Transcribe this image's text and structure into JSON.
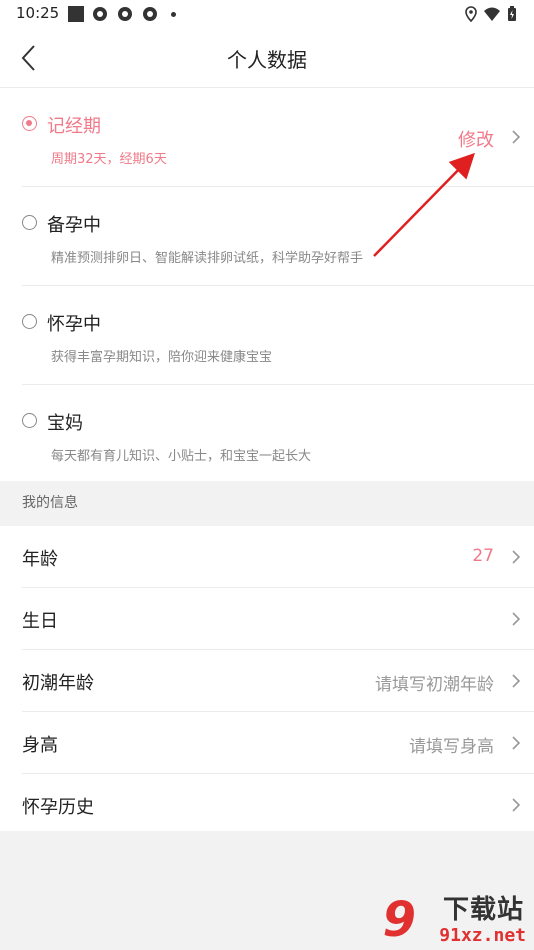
{
  "status_bar": {
    "time": "10:25"
  },
  "header": {
    "title": "个人数据"
  },
  "modes": [
    {
      "name": "记经期",
      "desc": "周期32天，经期6天",
      "selected": true,
      "edit_label": "修改"
    },
    {
      "name": "备孕中",
      "desc": "精准预测排卵日、智能解读排卵试纸，科学助孕好帮手",
      "selected": false
    },
    {
      "name": "怀孕中",
      "desc": "获得丰富孕期知识，陪你迎来健康宝宝",
      "selected": false
    },
    {
      "name": "宝妈",
      "desc": "每天都有育儿知识、小贴士，和宝宝一起长大",
      "selected": false
    }
  ],
  "info_section": {
    "title": "我的信息",
    "rows": [
      {
        "label": "年龄",
        "value": "27"
      },
      {
        "label": "生日",
        "value": ""
      },
      {
        "label": "初潮年龄",
        "value": "请填写初潮年龄"
      },
      {
        "label": "身高",
        "value": "请填写身高"
      },
      {
        "label": "怀孕历史",
        "value": ""
      }
    ]
  },
  "watermark": {
    "brand": "下载站",
    "domain": "91xz.net",
    "digit": "9"
  },
  "colors": {
    "accent": "#f07a8a",
    "annotation": "#e02020"
  }
}
